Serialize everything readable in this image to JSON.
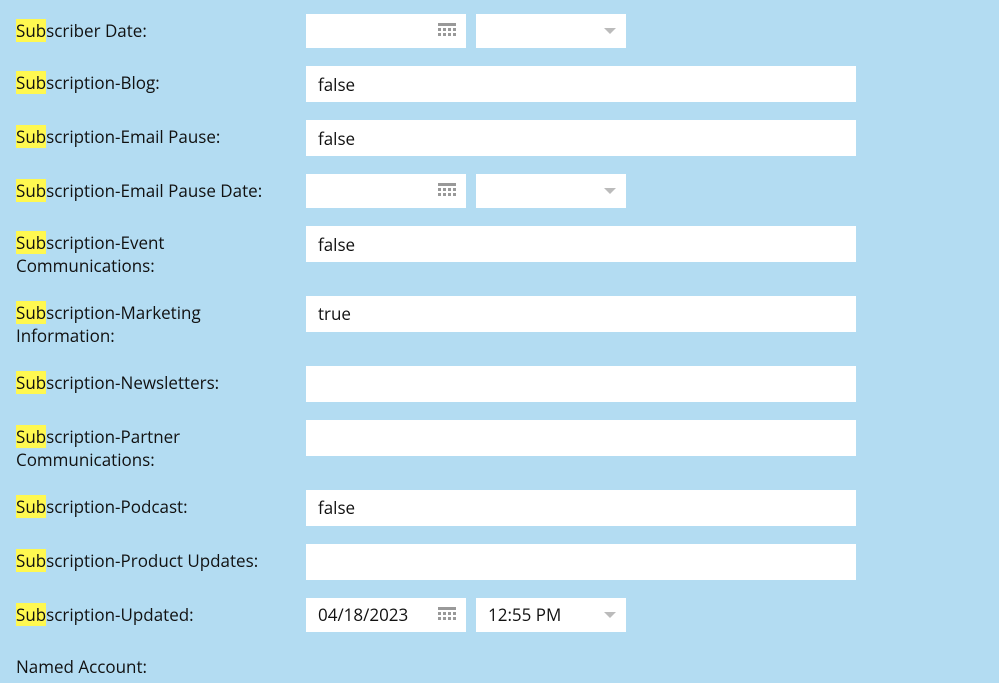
{
  "highlight_prefix": "Sub",
  "fields": {
    "subscriber_date": {
      "label_rest": "scriber Date:",
      "date_value": "",
      "time_value": ""
    },
    "subscription_blog": {
      "label_rest": "scription-Blog:",
      "value": "false"
    },
    "subscription_email_pause": {
      "label_rest": "scription-Email Pause:",
      "value": "false"
    },
    "subscription_email_pause_date": {
      "label_rest": "scription-Email Pause Date:",
      "date_value": "",
      "time_value": ""
    },
    "subscription_event_comm": {
      "label_rest": "scription-Event Communications:",
      "value": "false"
    },
    "subscription_marketing_info": {
      "label_rest": "scription-Marketing Information:",
      "value": "true"
    },
    "subscription_newsletters": {
      "label_rest": "scription-Newsletters:",
      "value": ""
    },
    "subscription_partner_comm": {
      "label_rest": "scription-Partner Communications:",
      "value": ""
    },
    "subscription_podcast": {
      "label_rest": "scription-Podcast:",
      "value": "false"
    },
    "subscription_product_updates": {
      "label_rest": "scription-Product Updates:",
      "value": ""
    },
    "subscription_updated": {
      "label_rest": "scription-Updated:",
      "date_value": "04/18/2023",
      "time_value": "12:55 PM"
    },
    "named_account": {
      "label": "Named Account:"
    }
  }
}
